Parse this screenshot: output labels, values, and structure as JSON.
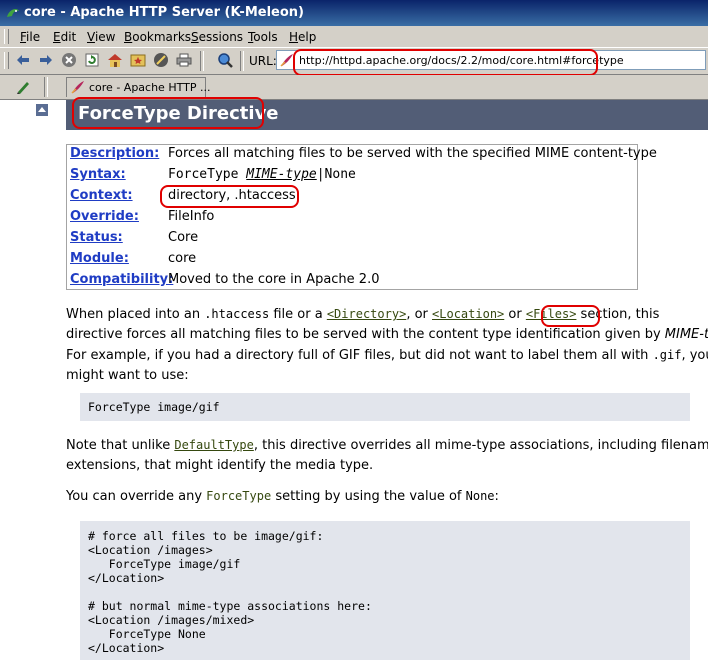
{
  "window": {
    "title": "core - Apache HTTP Server (K-Meleon)"
  },
  "menu": [
    "File",
    "Edit",
    "View",
    "Bookmarks",
    "Sessions",
    "Tools",
    "Help"
  ],
  "menu_underline": [
    "F",
    "E",
    "V",
    "B",
    "S",
    "T",
    "H"
  ],
  "toolbar": {
    "url_label": "URL:",
    "url": "http://httpd.apache.org/docs/2.2/mod/core.html#forcetype"
  },
  "tab": {
    "label": "core - Apache HTTP ..."
  },
  "page": {
    "heading": "ForceType Directive",
    "rows": [
      {
        "key": "Description:",
        "value": "Forces all matching files to be served with the specified MIME content-type"
      },
      {
        "key": "Syntax:",
        "value_prefix": "ForceType ",
        "value_italic": "MIME-type",
        "value_suffix": "|None"
      },
      {
        "key": "Context:",
        "value": "directory, .htaccess"
      },
      {
        "key": "Override:",
        "value": "FileInfo"
      },
      {
        "key": "Status:",
        "value": "Core"
      },
      {
        "key": "Module:",
        "value": "core"
      },
      {
        "key": "Compatibility:",
        "value": "Moved to the core in Apache 2.0"
      }
    ],
    "p1": {
      "a": "When placed into an ",
      "htaccess": ".htaccess",
      "b": " file or a ",
      "dir": "<Directory>",
      "c": ", or ",
      "loc": "<Location>",
      "d": " or ",
      "files": "<Files>",
      "e": " section, this",
      "line2a": "directive forces all matching files to be served with the content type identification given by ",
      "mime": "MIME-type",
      "line2b": ".",
      "line3a": "For example, if you had a directory full of GIF files, but did not want to label them all with ",
      "gif": ".gif",
      "line3b": ", you",
      "line4": "might want to use:"
    },
    "code1": "ForceType image/gif",
    "p2": {
      "a": "Note that unlike ",
      "link": "DefaultType",
      "b": ", this directive overrides all mime-type associations, including filename",
      "line2": "extensions, that might identify the media type."
    },
    "p3": {
      "a": "You can override any ",
      "link": "ForceType",
      "b": " setting by using the value of ",
      "none": "None",
      "c": ":"
    },
    "code2": [
      "# force all files to be image/gif:",
      "<Location /images>",
      "   ForceType image/gif",
      "</Location>",
      "",
      "# but normal mime-type associations here:",
      "<Location /images/mixed>",
      "   ForceType None",
      "</Location>"
    ]
  }
}
